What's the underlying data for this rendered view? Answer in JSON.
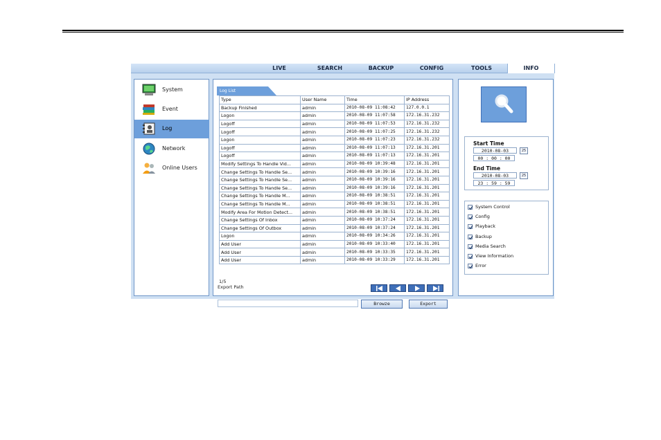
{
  "nav": {
    "tabs": [
      {
        "label": "LIVE"
      },
      {
        "label": "SEARCH"
      },
      {
        "label": "BACKUP"
      },
      {
        "label": "CONFIG"
      },
      {
        "label": "TOOLS"
      },
      {
        "label": "INFO"
      }
    ],
    "active_tab": "INFO"
  },
  "sidebar": {
    "items": [
      {
        "label": "System",
        "icon": "monitor-icon"
      },
      {
        "label": "Event",
        "icon": "books-icon"
      },
      {
        "label": "Log",
        "icon": "address-book-icon"
      },
      {
        "label": "Network",
        "icon": "globe-icon"
      },
      {
        "label": "Online Users",
        "icon": "users-icon"
      }
    ],
    "active": "Log"
  },
  "log": {
    "tab_label": "Log List",
    "columns": [
      "Type",
      "User Name",
      "Time",
      "IP Address"
    ],
    "rows": [
      [
        "Backup Finished",
        "admin",
        "2010-08-09 11:08:42",
        "127.0.0.1"
      ],
      [
        "Logon",
        "admin",
        "2010-08-09 11:07:58",
        "172.16.31.232"
      ],
      [
        "Logoff",
        "admin",
        "2010-08-09 11:07:53",
        "172.16.31.232"
      ],
      [
        "Logoff",
        "admin",
        "2010-08-09 11:07:25",
        "172.16.31.232"
      ],
      [
        "Logon",
        "admin",
        "2010-08-09 11:07:23",
        "172.16.31.232"
      ],
      [
        "Logoff",
        "admin",
        "2010-08-09 11:07:13",
        "172.16.31.201"
      ],
      [
        "Logoff",
        "admin",
        "2010-08-09 11:07:13",
        "172.16.31.201"
      ],
      [
        "Modify Settings To Handle Vid...",
        "admin",
        "2010-08-09 10:39:48",
        "172.16.31.201"
      ],
      [
        "Change Settings To Handle Se...",
        "admin",
        "2010-08-09 10:39:16",
        "172.16.31.201"
      ],
      [
        "Change Settings To Handle Se...",
        "admin",
        "2010-08-09 10:39:16",
        "172.16.31.201"
      ],
      [
        "Change Settings To Handle Se...",
        "admin",
        "2010-08-09 10:39:16",
        "172.16.31.201"
      ],
      [
        "Change Settings To Handle M...",
        "admin",
        "2010-08-09 10:38:51",
        "172.16.31.201"
      ],
      [
        "Change Settings To Handle M...",
        "admin",
        "2010-08-09 10:38:51",
        "172.16.31.201"
      ],
      [
        "Modify Area For Motion Detect...",
        "admin",
        "2010-08-09 10:38:51",
        "172.16.31.201"
      ],
      [
        "Change Settings Of Inbox",
        "admin",
        "2010-08-09 10:37:24",
        "172.16.31.201"
      ],
      [
        "Change Settings Of Outbox",
        "admin",
        "2010-08-09 10:37:24",
        "172.16.31.201"
      ],
      [
        "Logon",
        "admin",
        "2010-08-09 10:34:26",
        "172.16.31.201"
      ],
      [
        "Add User",
        "admin",
        "2010-08-09 10:33:40",
        "172.16.31.201"
      ],
      [
        "Add User",
        "admin",
        "2010-08-09 10:33:35",
        "172.16.31.201"
      ],
      [
        "Add User",
        "admin",
        "2010-08-09 10:33:29",
        "172.16.31.201"
      ]
    ],
    "page": "1/5",
    "export_label": "Export Path",
    "export_value": "",
    "browse_label": "Browze",
    "export_button_label": "Export"
  },
  "filter": {
    "search_icon": "magnifier-icon",
    "start_title": "Start Time",
    "start_date": "2010-08-03",
    "start_time": "00 : 00 : 00",
    "end_title": "End Time",
    "end_date": "2010-08-03",
    "end_time": "23 : 59 : 59",
    "calendar_label": "25",
    "categories": [
      {
        "label": "System Control",
        "checked": true
      },
      {
        "label": "Config",
        "checked": true
      },
      {
        "label": "Playback",
        "checked": true
      },
      {
        "label": "Backup",
        "checked": true
      },
      {
        "label": "Media Search",
        "checked": true
      },
      {
        "label": "View Information",
        "checked": true
      },
      {
        "label": "Error",
        "checked": true
      }
    ]
  }
}
